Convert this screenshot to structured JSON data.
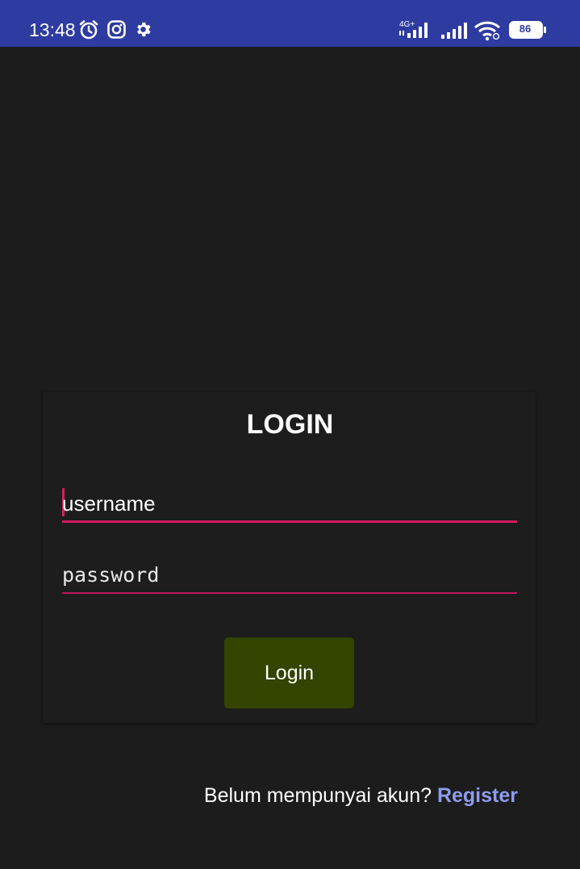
{
  "status_bar": {
    "time": "13:48",
    "battery": "86",
    "network_label": "4G+",
    "icons": [
      "alarm-icon",
      "instagram-icon",
      "gear-icon",
      "signal-icon",
      "signal-icon",
      "wifi-icon",
      "battery-icon"
    ],
    "background_color": "#2e3ba0"
  },
  "login": {
    "title": "LOGIN",
    "username_placeholder": "username",
    "password_placeholder": "password",
    "button_label": "Login",
    "accent_color": "#d81b60",
    "button_color": "#334500"
  },
  "footer": {
    "prompt": "Belum mempunyai akun? ",
    "register_label": "Register",
    "link_color": "#8f9bee"
  }
}
